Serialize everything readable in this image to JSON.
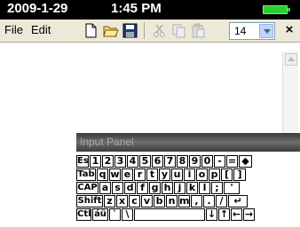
{
  "status": {
    "date": "2009-1-29",
    "time": "1:45 PM"
  },
  "menu": {
    "file": "File",
    "edit": "Edit"
  },
  "toolbar": {
    "font_size": "14",
    "close": "×"
  },
  "input_panel": {
    "title": "Input Panel"
  },
  "keyboard": {
    "rows": [
      [
        "Esc",
        "1",
        "2",
        "3",
        "4",
        "5",
        "6",
        "7",
        "8",
        "9",
        "0",
        "-",
        "=",
        "◆"
      ],
      [
        "Tab",
        "q",
        "w",
        "e",
        "r",
        "t",
        "y",
        "u",
        "i",
        "o",
        "p",
        "[",
        "]"
      ],
      [
        "CAP",
        "a",
        "s",
        "d",
        "f",
        "g",
        "h",
        "j",
        "k",
        "l",
        ";",
        "'"
      ],
      [
        "Shift",
        "z",
        "x",
        "c",
        "v",
        "b",
        "n",
        "m",
        ",",
        ".",
        "/",
        "↵"
      ],
      [
        "Ctl",
        "áü",
        "`",
        "\\",
        "",
        "↓",
        "↑",
        "←",
        "→"
      ]
    ]
  }
}
